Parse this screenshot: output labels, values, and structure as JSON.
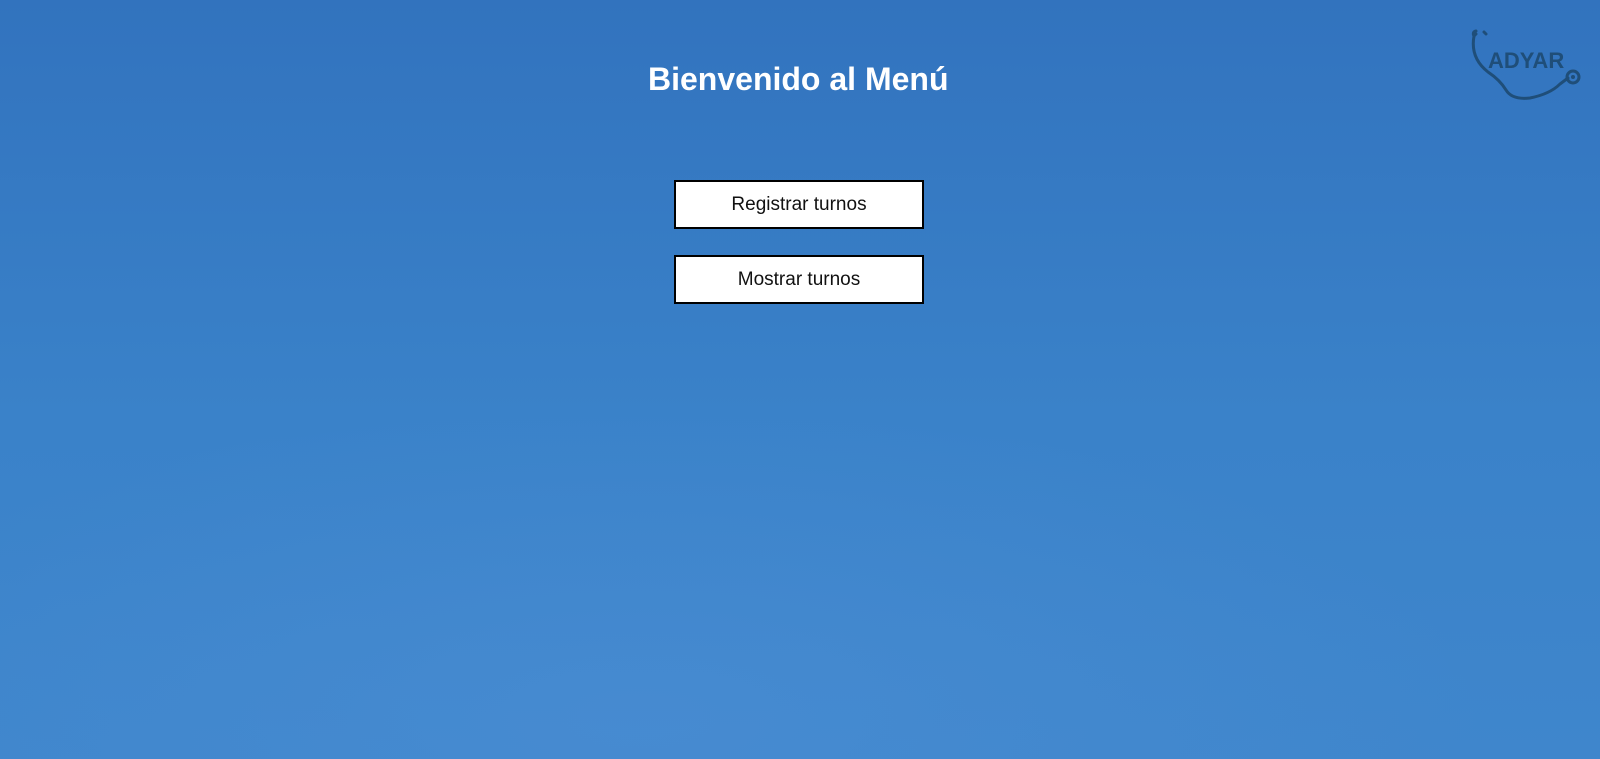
{
  "page": {
    "title": "Bienvenido al Menú"
  },
  "menu": {
    "register_label": "Registrar turnos",
    "show_label": "Mostrar turnos"
  },
  "logo": {
    "text": "ADYAR",
    "icon": "stethoscope-icon"
  },
  "colors": {
    "background": "#3a7fc6",
    "title": "#ffffff",
    "button_bg": "#ffffff",
    "button_border": "#000000",
    "logo": "#1f4e79"
  }
}
